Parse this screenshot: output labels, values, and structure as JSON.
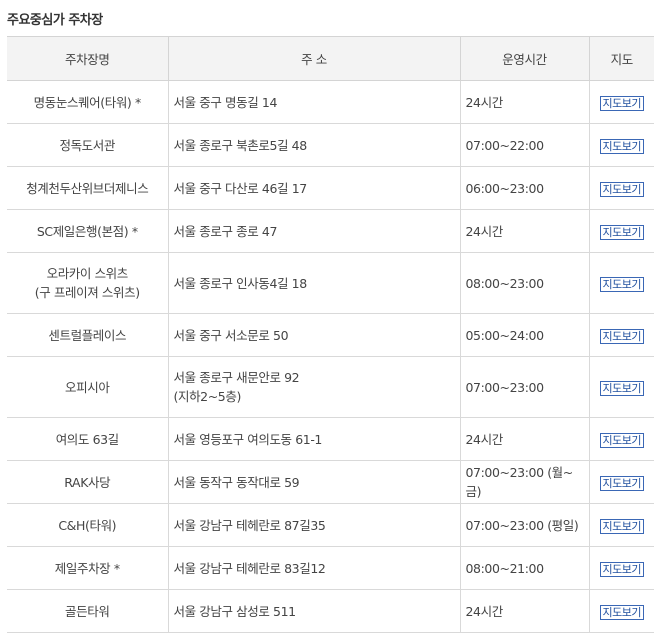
{
  "section_title": "주요중심가 주차장",
  "headers": {
    "name": "주차장명",
    "address": "주 소",
    "hours": "운영시간",
    "map": "지도"
  },
  "map_button_label": "지도보기",
  "rows": [
    {
      "name": [
        "명동눈스퀘어(타워) *"
      ],
      "address": [
        "서울 중구 명동길 14"
      ],
      "hours": "24시간"
    },
    {
      "name": [
        "정독도서관"
      ],
      "address": [
        "서울 종로구 북촌로5길 48"
      ],
      "hours": "07:00~22:00"
    },
    {
      "name": [
        "청계천두산위브더제니스"
      ],
      "address": [
        "서울 중구 다산로 46길 17"
      ],
      "hours": "06:00~23:00"
    },
    {
      "name": [
        "SC제일은행(본점) *"
      ],
      "address": [
        "서울 종로구 종로 47"
      ],
      "hours": "24시간"
    },
    {
      "name": [
        "오라카이 스위츠",
        "(구 프레이져 스위츠)"
      ],
      "address": [
        "서울 종로구 인사동4길 18"
      ],
      "hours": "08:00~23:00"
    },
    {
      "name": [
        "센트럴플레이스"
      ],
      "address": [
        "서울 중구 서소문로 50"
      ],
      "hours": "05:00~24:00"
    },
    {
      "name": [
        "오피시아"
      ],
      "address": [
        "서울 종로구 새문안로 92",
        "(지하2~5층)"
      ],
      "hours": "07:00~23:00"
    },
    {
      "name": [
        "여의도 63길"
      ],
      "address": [
        "서울 영등포구 여의도동 61-1"
      ],
      "hours": "24시간"
    },
    {
      "name": [
        "RAK사당"
      ],
      "address": [
        "서울 동작구 동작대로 59"
      ],
      "hours": "07:00~23:00 (월~금)"
    },
    {
      "name": [
        "C&H(타워)"
      ],
      "address": [
        "서울 강남구 테헤란로 87길35"
      ],
      "hours": "07:00~23:00 (평일)"
    },
    {
      "name": [
        "제일주차장 *"
      ],
      "address": [
        "서울 강남구 테헤란로 83길12"
      ],
      "hours": "08:00~21:00"
    },
    {
      "name": [
        "골든타워"
      ],
      "address": [
        "서울 강남구 삼성로 511"
      ],
      "hours": "24시간"
    }
  ]
}
